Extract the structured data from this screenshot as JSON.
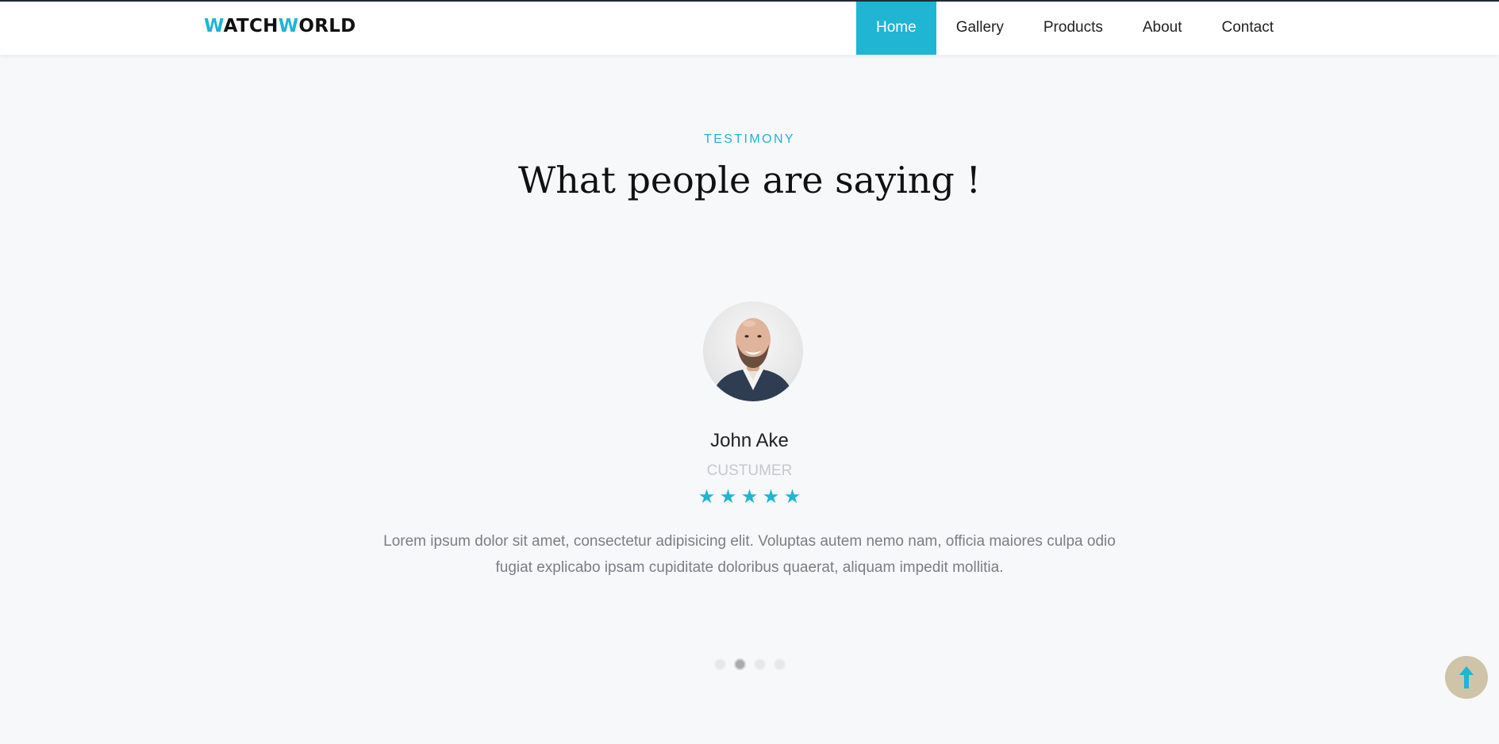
{
  "header": {
    "logo": {
      "first_letter": "W",
      "part1": "ATCH",
      "second_letter": "W",
      "part2": "ORLD"
    },
    "nav": [
      "Home",
      "Gallery",
      "Products",
      "About",
      "Contact"
    ],
    "active_nav": "Home"
  },
  "section": {
    "subtitle": "TESTIMONY",
    "title": "What people are saying !"
  },
  "testimonial": {
    "name": "John Ake",
    "role": "CUSTUMER",
    "rating": 5,
    "star_glyph": "★",
    "quote": "Lorem ipsum dolor sit amet, consectetur adipisicing elit. Voluptas autem nemo nam, officia maiores culpa odio fugiat explicabo ipsam cupiditate doloribus quaerat, aliquam impedit mollitia."
  },
  "carousel": {
    "slide_count": 4,
    "active_index": 1
  },
  "scroll_top": {
    "icon": "arrow-up-icon"
  },
  "colors": {
    "accent": "#1fb5d3",
    "background": "#f7f8fa",
    "scroll_button": "#cfc3a8",
    "header_top_border": "#212b36"
  }
}
